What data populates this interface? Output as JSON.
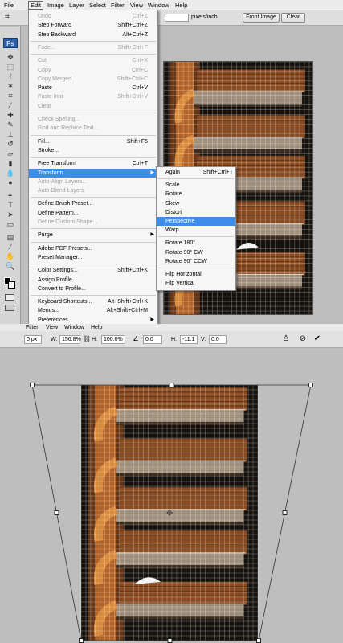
{
  "menubar": {
    "items": [
      "File",
      "Edit",
      "Image",
      "Layer",
      "Select",
      "Filter",
      "View",
      "Window",
      "Help"
    ],
    "active": "Edit"
  },
  "options_bar": {
    "units": "pixels/inch",
    "front_image": "Front Image",
    "clear": "Clear"
  },
  "toolbox": {
    "logo": "Ps"
  },
  "edit_menu": [
    {
      "label": "Undo",
      "shortcut": "Ctrl+Z",
      "disabled": true
    },
    {
      "label": "Step Forward",
      "shortcut": "Shift+Ctrl+Z",
      "disabled": false
    },
    {
      "label": "Step Backward",
      "shortcut": "Alt+Ctrl+Z",
      "disabled": false
    },
    {
      "sep": true
    },
    {
      "label": "Fade...",
      "shortcut": "Shift+Ctrl+F",
      "disabled": true
    },
    {
      "sep": true
    },
    {
      "label": "Cut",
      "shortcut": "Ctrl+X",
      "disabled": true
    },
    {
      "label": "Copy",
      "shortcut": "Ctrl+C",
      "disabled": true
    },
    {
      "label": "Copy Merged",
      "shortcut": "Shift+Ctrl+C",
      "disabled": true
    },
    {
      "label": "Paste",
      "shortcut": "Ctrl+V",
      "disabled": false
    },
    {
      "label": "Paste Into",
      "shortcut": "Shift+Ctrl+V",
      "disabled": true
    },
    {
      "label": "Clear",
      "shortcut": "",
      "disabled": true
    },
    {
      "sep": true
    },
    {
      "label": "Check Spelling...",
      "shortcut": "",
      "disabled": true
    },
    {
      "label": "Find and Replace Text...",
      "shortcut": "",
      "disabled": true
    },
    {
      "sep": true
    },
    {
      "label": "Fill...",
      "shortcut": "Shift+F5",
      "disabled": false
    },
    {
      "label": "Stroke...",
      "shortcut": "",
      "disabled": false
    },
    {
      "sep": true
    },
    {
      "label": "Free Transform",
      "shortcut": "Ctrl+T",
      "disabled": false
    },
    {
      "label": "Transform",
      "shortcut": "",
      "disabled": false,
      "submenu": true,
      "highlighted": true
    },
    {
      "label": "Auto-Align Layers...",
      "shortcut": "",
      "disabled": true
    },
    {
      "label": "Auto-Blend Layers",
      "shortcut": "",
      "disabled": true
    },
    {
      "sep": true
    },
    {
      "label": "Define Brush Preset...",
      "shortcut": "",
      "disabled": false
    },
    {
      "label": "Define Pattern...",
      "shortcut": "",
      "disabled": false
    },
    {
      "label": "Define Custom Shape...",
      "shortcut": "",
      "disabled": true
    },
    {
      "sep": true
    },
    {
      "label": "Purge",
      "shortcut": "",
      "disabled": false,
      "submenu": true
    },
    {
      "sep": true
    },
    {
      "label": "Adobe PDF Presets...",
      "shortcut": "",
      "disabled": false
    },
    {
      "label": "Preset Manager...",
      "shortcut": "",
      "disabled": false
    },
    {
      "sep": true
    },
    {
      "label": "Color Settings...",
      "shortcut": "Shift+Ctrl+K",
      "disabled": false
    },
    {
      "label": "Assign Profile...",
      "shortcut": "",
      "disabled": false
    },
    {
      "label": "Convert to Profile...",
      "shortcut": "",
      "disabled": false
    },
    {
      "sep": true
    },
    {
      "label": "Keyboard Shortcuts...",
      "shortcut": "Alt+Shift+Ctrl+K",
      "disabled": false
    },
    {
      "label": "Menus...",
      "shortcut": "Alt+Shift+Ctrl+M",
      "disabled": false
    },
    {
      "label": "Preferences",
      "shortcut": "",
      "disabled": false,
      "submenu": true
    }
  ],
  "transform_menu": [
    {
      "label": "Again",
      "shortcut": "Shift+Ctrl+T"
    },
    {
      "sep": true
    },
    {
      "label": "Scale"
    },
    {
      "label": "Rotate"
    },
    {
      "label": "Skew"
    },
    {
      "label": "Distort"
    },
    {
      "label": "Perspective",
      "highlighted": true
    },
    {
      "label": "Warp"
    },
    {
      "sep": true
    },
    {
      "label": "Rotate 180°"
    },
    {
      "label": "Rotate 90° CW"
    },
    {
      "label": "Rotate 90° CCW"
    },
    {
      "sep": true
    },
    {
      "label": "Flip Horizontal"
    },
    {
      "label": "Flip Vertical"
    }
  ],
  "bottom_menubar": {
    "items": [
      "Filter",
      "View",
      "Window",
      "Help"
    ]
  },
  "transform_options": {
    "x_value": "0 px",
    "w_label": "W:",
    "w_value": "156.8%",
    "h_label": "H:",
    "h_value": "100.0%",
    "angle_value": "0.0",
    "h_skew_label": "H:",
    "h_skew_value": "-11.1",
    "v_skew_label": "V:",
    "v_skew_value": "0.0"
  },
  "colors": {
    "highlight": "#3d8ee8",
    "wall": "#c06a2a",
    "balcony": "#9a8a78",
    "grid": "#ffffff"
  }
}
